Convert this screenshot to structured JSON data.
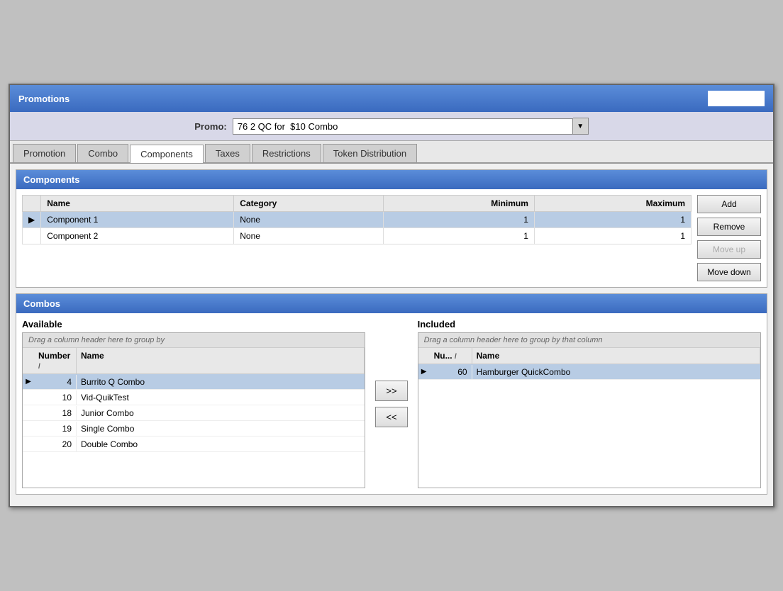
{
  "app": {
    "title": "Promotions"
  },
  "promo": {
    "label": "Promo:",
    "value": "76 2 QC for  $10 Combo"
  },
  "tabs": [
    {
      "label": "Promotion",
      "active": false
    },
    {
      "label": "Combo",
      "active": false
    },
    {
      "label": "Components",
      "active": true
    },
    {
      "label": "Taxes",
      "active": false
    },
    {
      "label": "Restrictions",
      "active": false
    },
    {
      "label": "Token Distribution",
      "active": false
    }
  ],
  "components_section": {
    "title": "Components",
    "columns": [
      "Name",
      "Category",
      "Minimum",
      "Maximum"
    ],
    "rows": [
      {
        "indicator": "▶",
        "name": "Component 1",
        "category": "None",
        "minimum": "1",
        "maximum": "1",
        "selected": true
      },
      {
        "indicator": "",
        "name": "Component 2",
        "category": "None",
        "minimum": "1",
        "maximum": "1",
        "selected": false
      }
    ],
    "buttons": {
      "add": "Add",
      "remove": "Remove",
      "move_up": "Move up",
      "move_down": "Move down"
    }
  },
  "combos_section": {
    "title": "Combos",
    "available": {
      "label": "Available",
      "drag_hint": "Drag a column header here to group by",
      "columns": [
        {
          "label": "Number",
          "sort": "/"
        },
        {
          "label": "Name",
          "sort": ""
        }
      ],
      "rows": [
        {
          "indicator": "▶",
          "number": "4",
          "name": "Burrito Q Combo",
          "selected": true
        },
        {
          "indicator": "",
          "number": "10",
          "name": "Vid-QuikTest",
          "selected": false
        },
        {
          "indicator": "",
          "number": "18",
          "name": "Junior Combo",
          "selected": false
        },
        {
          "indicator": "",
          "number": "19",
          "name": "Single Combo",
          "selected": false
        },
        {
          "indicator": "",
          "number": "20",
          "name": "Double Combo",
          "selected": false
        }
      ]
    },
    "transfer": {
      "include": ">>",
      "exclude": "<<"
    },
    "included": {
      "label": "Included",
      "drag_hint": "Drag a column header here to group by that column",
      "columns": [
        {
          "label": "Nu...",
          "sort": "/"
        },
        {
          "label": "Name",
          "sort": ""
        }
      ],
      "rows": [
        {
          "indicator": "▶",
          "number": "60",
          "name": "Hamburger QuickCombo",
          "selected": true
        }
      ]
    }
  }
}
